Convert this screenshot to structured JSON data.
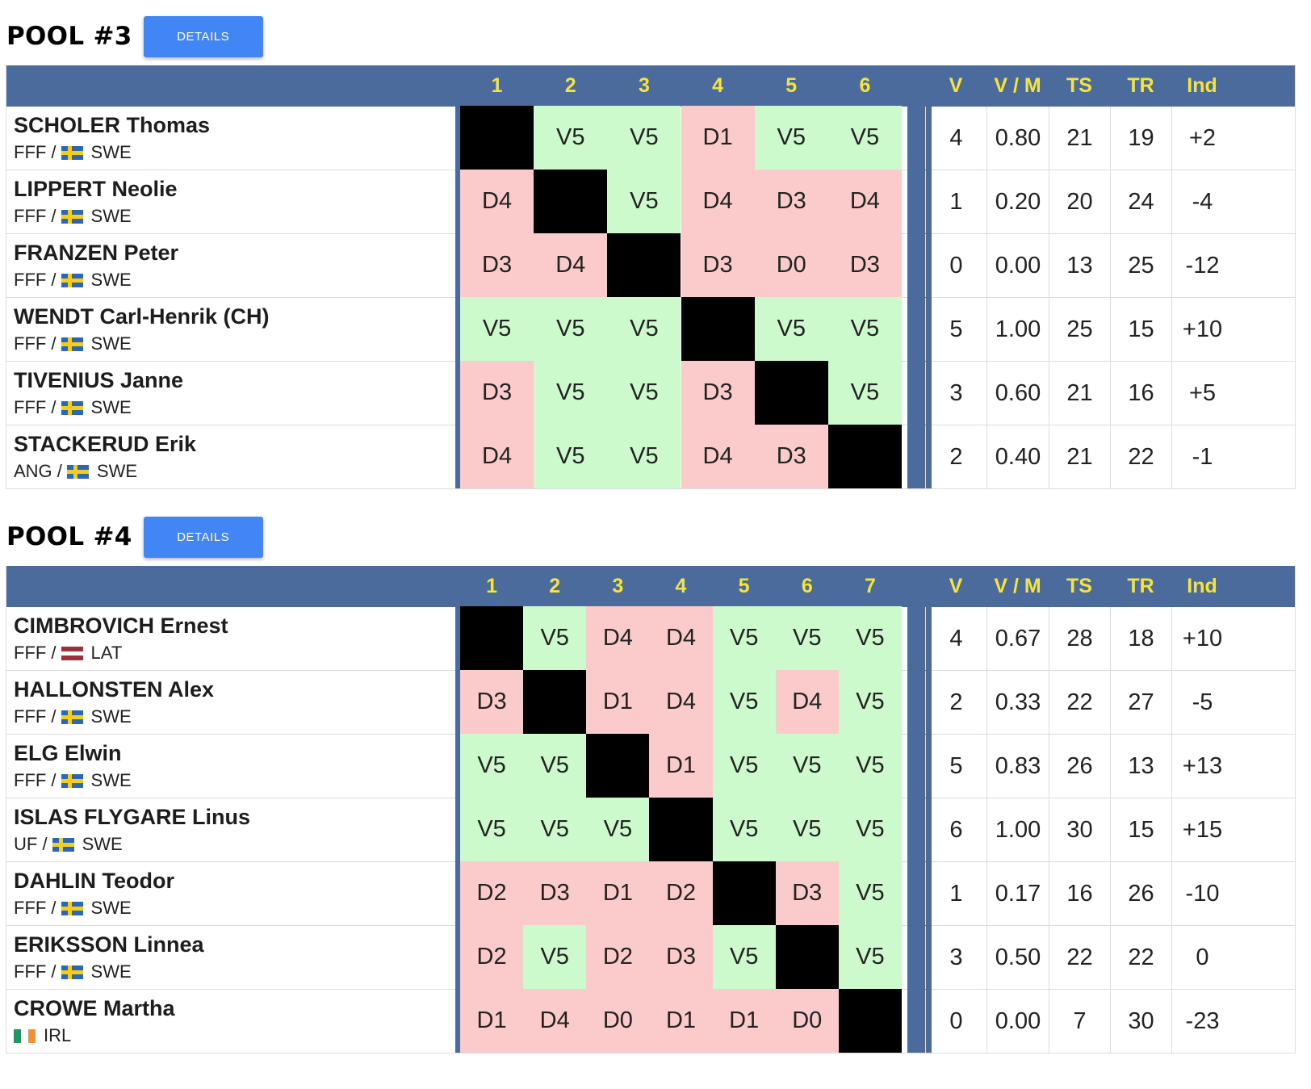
{
  "stat_headers": [
    "V",
    "V / M",
    "TS",
    "TR",
    "Ind"
  ],
  "pools": [
    {
      "title": "POOL #3",
      "details_label": "DETAILS",
      "columns": [
        "1",
        "2",
        "3",
        "4",
        "5",
        "6"
      ],
      "fencers": [
        {
          "index": "1",
          "name": "SCHOLER Thomas",
          "club": "FFF /",
          "country": "SWE",
          "flag": "swe",
          "bouts": [
            "",
            "V5",
            "V5",
            "D1",
            "V5",
            "V5"
          ],
          "stats": [
            "4",
            "0.80",
            "21",
            "19",
            "+2"
          ]
        },
        {
          "index": "2",
          "name": "LIPPERT Neolie",
          "club": "FFF /",
          "country": "SWE",
          "flag": "swe",
          "bouts": [
            "D4",
            "",
            "V5",
            "D4",
            "D3",
            "D4"
          ],
          "stats": [
            "1",
            "0.20",
            "20",
            "24",
            "-4"
          ]
        },
        {
          "index": "3",
          "name": "FRANZEN Peter",
          "club": "FFF /",
          "country": "SWE",
          "flag": "swe",
          "bouts": [
            "D3",
            "D4",
            "",
            "D3",
            "D0",
            "D3"
          ],
          "stats": [
            "0",
            "0.00",
            "13",
            "25",
            "-12"
          ]
        },
        {
          "index": "4",
          "name": "WENDT Carl-Henrik (CH)",
          "club": "FFF /",
          "country": "SWE",
          "flag": "swe",
          "bouts": [
            "V5",
            "V5",
            "V5",
            "",
            "V5",
            "V5"
          ],
          "stats": [
            "5",
            "1.00",
            "25",
            "15",
            "+10"
          ]
        },
        {
          "index": "5",
          "name": "TIVENIUS Janne",
          "club": "FFF /",
          "country": "SWE",
          "flag": "swe",
          "bouts": [
            "D3",
            "V5",
            "V5",
            "D3",
            "",
            "V5"
          ],
          "stats": [
            "3",
            "0.60",
            "21",
            "16",
            "+5"
          ]
        },
        {
          "index": "6",
          "name": "STACKERUD Erik",
          "club": "ANG /",
          "country": "SWE",
          "flag": "swe",
          "bouts": [
            "D4",
            "V5",
            "V5",
            "D4",
            "D3",
            ""
          ],
          "stats": [
            "2",
            "0.40",
            "21",
            "22",
            "-1"
          ]
        }
      ]
    },
    {
      "title": "POOL #4",
      "details_label": "DETAILS",
      "columns": [
        "1",
        "2",
        "3",
        "4",
        "5",
        "6",
        "7"
      ],
      "fencers": [
        {
          "index": "1",
          "name": "CIMBROVICH Ernest",
          "club": "FFF /",
          "country": "LAT",
          "flag": "lat",
          "bouts": [
            "",
            "V5",
            "D4",
            "D4",
            "V5",
            "V5",
            "V5"
          ],
          "stats": [
            "4",
            "0.67",
            "28",
            "18",
            "+10"
          ]
        },
        {
          "index": "2",
          "name": "HALLONSTEN Alex",
          "club": "FFF /",
          "country": "SWE",
          "flag": "swe",
          "bouts": [
            "D3",
            "",
            "D1",
            "D4",
            "V5",
            "D4",
            "V5"
          ],
          "stats": [
            "2",
            "0.33",
            "22",
            "27",
            "-5"
          ]
        },
        {
          "index": "3",
          "name": "ELG Elwin",
          "club": "FFF /",
          "country": "SWE",
          "flag": "swe",
          "bouts": [
            "V5",
            "V5",
            "",
            "D1",
            "V5",
            "V5",
            "V5"
          ],
          "stats": [
            "5",
            "0.83",
            "26",
            "13",
            "+13"
          ]
        },
        {
          "index": "4",
          "name": "ISLAS FLYGARE Linus",
          "club": "UF /",
          "country": "SWE",
          "flag": "swe",
          "bouts": [
            "V5",
            "V5",
            "V5",
            "",
            "V5",
            "V5",
            "V5"
          ],
          "stats": [
            "6",
            "1.00",
            "30",
            "15",
            "+15"
          ]
        },
        {
          "index": "5",
          "name": "DAHLIN Teodor",
          "club": "FFF /",
          "country": "SWE",
          "flag": "swe",
          "bouts": [
            "D2",
            "D3",
            "D1",
            "D2",
            "",
            "D3",
            "V5"
          ],
          "stats": [
            "1",
            "0.17",
            "16",
            "26",
            "-10"
          ]
        },
        {
          "index": "6",
          "name": "ERIKSSON Linnea",
          "club": "FFF /",
          "country": "SWE",
          "flag": "swe",
          "bouts": [
            "D2",
            "V5",
            "D2",
            "D3",
            "V5",
            "",
            "V5"
          ],
          "stats": [
            "3",
            "0.50",
            "22",
            "22",
            "0"
          ]
        },
        {
          "index": "7",
          "name": "CROWE Martha",
          "club": "",
          "country": "IRL",
          "flag": "irl",
          "bouts": [
            "D1",
            "D4",
            "D0",
            "D1",
            "D1",
            "D0",
            ""
          ],
          "stats": [
            "0",
            "0.00",
            "7",
            "30",
            "-23"
          ]
        }
      ]
    }
  ],
  "colors": {
    "header_bg": "#4a6b9c",
    "header_text": "#f7e43a",
    "victory_bg": "#ccfacc",
    "defeat_bg": "#fbcaca",
    "self_bout_bg": "#000000",
    "details_button_bg": "#4285f4"
  }
}
